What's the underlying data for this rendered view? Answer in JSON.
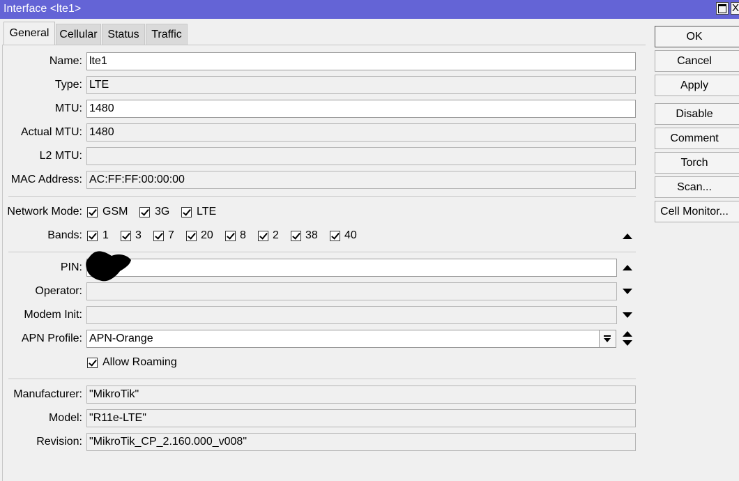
{
  "window": {
    "title": "Interface <lte1>",
    "close_glyph": "X"
  },
  "tabs": [
    {
      "label": "General",
      "active": true
    },
    {
      "label": "Cellular",
      "active": false
    },
    {
      "label": "Status",
      "active": false
    },
    {
      "label": "Traffic",
      "active": false
    }
  ],
  "fields": {
    "name": {
      "label": "Name:",
      "value": "lte1"
    },
    "type": {
      "label": "Type:",
      "value": "LTE"
    },
    "mtu": {
      "label": "MTU:",
      "value": "1480"
    },
    "actual_mtu": {
      "label": "Actual MTU:",
      "value": "1480"
    },
    "l2_mtu": {
      "label": "L2 MTU:",
      "value": ""
    },
    "mac_address": {
      "label": "MAC Address:",
      "value": "AC:FF:FF:00:00:00"
    },
    "pin": {
      "label": "PIN:",
      "value": ""
    },
    "operator": {
      "label": "Operator:",
      "value": ""
    },
    "modem_init": {
      "label": "Modem Init:",
      "value": ""
    },
    "apn_profile": {
      "label": "APN Profile:",
      "value": "APN-Orange"
    },
    "manufacturer": {
      "label": "Manufacturer:",
      "value": "\"MikroTik\""
    },
    "model": {
      "label": "Model:",
      "value": "\"R11e-LTE\""
    },
    "revision": {
      "label": "Revision:",
      "value": "\"MikroTik_CP_2.160.000_v008\""
    }
  },
  "network_mode": {
    "label": "Network Mode:",
    "options": [
      {
        "label": "GSM",
        "checked": true
      },
      {
        "label": "3G",
        "checked": true
      },
      {
        "label": "LTE",
        "checked": true
      }
    ]
  },
  "bands": {
    "label": "Bands:",
    "options": [
      {
        "label": "1",
        "checked": true
      },
      {
        "label": "3",
        "checked": true
      },
      {
        "label": "7",
        "checked": true
      },
      {
        "label": "20",
        "checked": true
      },
      {
        "label": "8",
        "checked": true
      },
      {
        "label": "2",
        "checked": true
      },
      {
        "label": "38",
        "checked": true
      },
      {
        "label": "40",
        "checked": true
      }
    ]
  },
  "allow_roaming": {
    "label": "Allow Roaming",
    "checked": true
  },
  "buttons": {
    "ok": "OK",
    "cancel": "Cancel",
    "apply": "Apply",
    "disable": "Disable",
    "comment": "Comment",
    "torch": "Torch",
    "scan": "Scan...",
    "cell_monitor": "Cell Monitor..."
  },
  "colors": {
    "titlebar": "#6464d6",
    "background": "#f0f0f0",
    "editable_field": "#ffffff",
    "readonly_field": "#f0f0f0"
  }
}
